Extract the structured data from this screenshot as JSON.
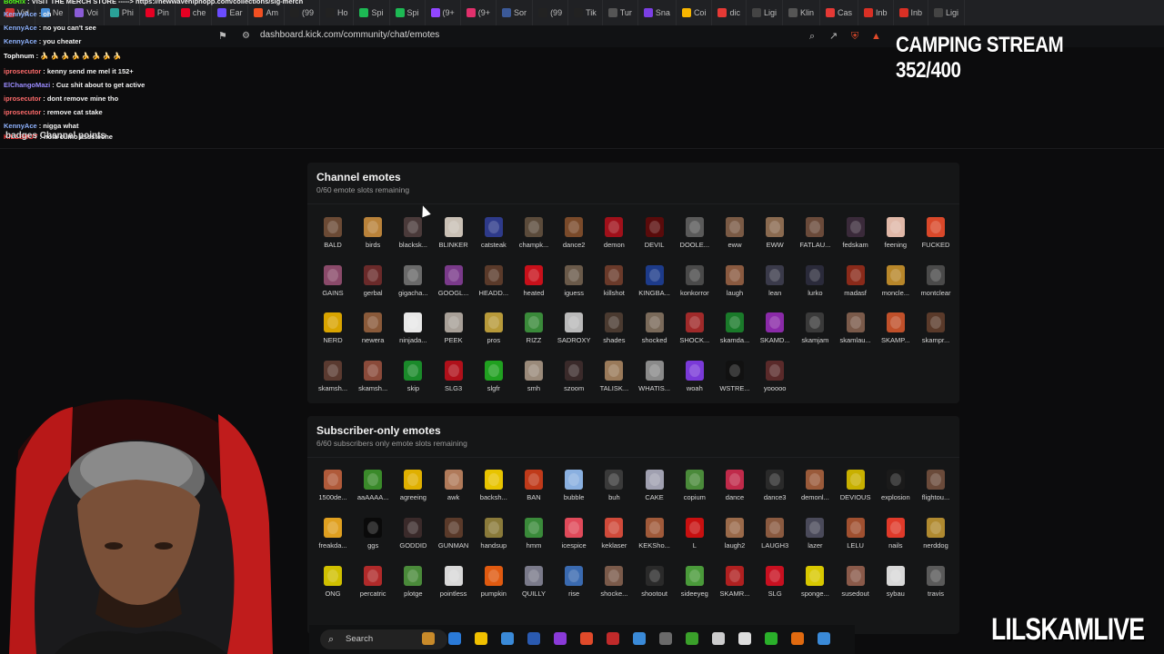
{
  "browser": {
    "tabs": [
      {
        "label": "Vid",
        "color": "#cc3333"
      },
      {
        "label": "Ne",
        "color": "#4a90d9"
      },
      {
        "label": "Voi",
        "color": "#8a5cd6"
      },
      {
        "label": "Phi",
        "color": "#2aa198"
      },
      {
        "label": "Pin",
        "color": "#e60023"
      },
      {
        "label": "che",
        "color": "#e60023"
      },
      {
        "label": "Ear",
        "color": "#6a4cff"
      },
      {
        "label": "Am",
        "color": "#f25022"
      },
      {
        "label": "(99",
        "color": "#222"
      },
      {
        "label": "Ho",
        "color": "#222"
      },
      {
        "label": "Spi",
        "color": "#1db954"
      },
      {
        "label": "Spi",
        "color": "#1db954"
      },
      {
        "label": "(9+",
        "color": "#9146ff"
      },
      {
        "label": "(9+",
        "color": "#e1306c"
      },
      {
        "label": "Sor",
        "color": "#3b5998"
      },
      {
        "label": "(99",
        "color": "#222"
      },
      {
        "label": "Tik",
        "color": "#222"
      },
      {
        "label": "Tur",
        "color": "#555"
      },
      {
        "label": "Sna",
        "color": "#7b3fe4"
      },
      {
        "label": "Coi",
        "color": "#f7b500"
      },
      {
        "label": "dic",
        "color": "#e53935"
      },
      {
        "label": "Ligi",
        "color": "#444"
      },
      {
        "label": "Klin",
        "color": "#555"
      },
      {
        "label": "Cas",
        "color": "#e53935"
      },
      {
        "label": "Inb",
        "color": "#d93025"
      },
      {
        "label": "Inb",
        "color": "#d93025"
      },
      {
        "label": "Ligi",
        "color": "#444"
      }
    ],
    "url": "dashboard.kick.com/community/chat/emotes"
  },
  "chat": {
    "lines": [
      {
        "user": "BotRix",
        "msg": ": VISIT THE MERCH STORE -----> https://newwavehiphopp.com/collections/slg-merch",
        "ucolor": "#53fc18"
      },
      {
        "user": "KennyAce",
        "msg": ": oh",
        "ucolor": "#8fb3ff"
      },
      {
        "user": "KennyAce",
        "msg": ": no you can't see",
        "ucolor": "#8fb3ff"
      },
      {
        "user": "KennyAce",
        "msg": ": you cheater",
        "ucolor": "#8fb3ff"
      },
      {
        "user": "Tophnum",
        "msg": ": 🍌 🍌 🍌 🍌 🍌 🍌 🍌 🍌",
        "ucolor": "#ffffff"
      },
      {
        "user": "iprosecutor",
        "msg": ": kenny send me mel it 152+",
        "ucolor": "#ff6b6b"
      },
      {
        "user": "ElChangoMazi",
        "msg": ": Cuz shit about to get active",
        "ucolor": "#9b8cff"
      },
      {
        "user": "iprosecutor",
        "msg": ": dont remove mine tho",
        "ucolor": "#ff6b6b"
      },
      {
        "user": "iprosecutor",
        "msg": ": remove cat stake",
        "ucolor": "#ff6b6b"
      },
      {
        "user": "KennyAce",
        "msg": ": nigga what",
        "ucolor": "#8fb3ff"
      },
      {
        "user": "KILLSHOT",
        "msg": ": hola cumo asssteche",
        "ucolor": "#ff3b3b"
      }
    ]
  },
  "stream_title": "CAMPING STREAM 352/400",
  "nav_partial": "badges   Channel points",
  "channel_emotes": {
    "title": "Channel emotes",
    "subtitle": "0/60 emote slots remaining",
    "items": [
      {
        "n": "BALD",
        "c": "#6b4a35"
      },
      {
        "n": "birds",
        "c": "#b9823a"
      },
      {
        "n": "blacksk...",
        "c": "#4a3a3a"
      },
      {
        "n": "BLINKER",
        "c": "#c9c0b5"
      },
      {
        "n": "catsteak",
        "c": "#2e3a8a"
      },
      {
        "n": "champk...",
        "c": "#5b4b3b"
      },
      {
        "n": "dance2",
        "c": "#7a4a2a"
      },
      {
        "n": "demon",
        "c": "#a0101a"
      },
      {
        "n": "DEVIL",
        "c": "#5a0b0b"
      },
      {
        "n": "DOOLE...",
        "c": "#5a5a5a"
      },
      {
        "n": "eww",
        "c": "#7a5a45"
      },
      {
        "n": "EWW",
        "c": "#8a6a50"
      },
      {
        "n": "FATLAU...",
        "c": "#6a4a3a"
      },
      {
        "n": "fedskam",
        "c": "#3a2a3a"
      },
      {
        "n": "feening",
        "c": "#e0b8a8"
      },
      {
        "n": "FUCKED",
        "c": "#d9482a"
      },
      {
        "n": "GAINS",
        "c": "#8a4a6a"
      },
      {
        "n": "gerbal",
        "c": "#6a2a2a"
      },
      {
        "n": "gigacha...",
        "c": "#6a6a6a"
      },
      {
        "n": "GOOGL...",
        "c": "#7a3a8a"
      },
      {
        "n": "HEADD...",
        "c": "#5a3a2a"
      },
      {
        "n": "heated",
        "c": "#c8101a"
      },
      {
        "n": "iguess",
        "c": "#6a5a4a"
      },
      {
        "n": "killshot",
        "c": "#6a3a2a"
      },
      {
        "n": "KINGBA...",
        "c": "#1d3b8a"
      },
      {
        "n": "konkorror",
        "c": "#4a4a4a"
      },
      {
        "n": "laugh",
        "c": "#8a5a40"
      },
      {
        "n": "lean",
        "c": "#3a3a4a"
      },
      {
        "n": "lurko",
        "c": "#2a2a3a"
      },
      {
        "n": "madasf",
        "c": "#8a2a1a"
      },
      {
        "n": "moncle...",
        "c": "#b8872a"
      },
      {
        "n": "montclear",
        "c": "#4a4a4a"
      },
      {
        "n": "NERD",
        "c": "#d9a400"
      },
      {
        "n": "newera",
        "c": "#8a5a3a"
      },
      {
        "n": "ninjada...",
        "c": "#e8e8e8"
      },
      {
        "n": "PEEK",
        "c": "#a8a098"
      },
      {
        "n": "pros",
        "c": "#b89a3a"
      },
      {
        "n": "RIZZ",
        "c": "#3a8a3a"
      },
      {
        "n": "SADROXY",
        "c": "#bababa"
      },
      {
        "n": "shades",
        "c": "#4a3a30"
      },
      {
        "n": "shocked",
        "c": "#7a6a5a"
      },
      {
        "n": "SHOCK...",
        "c": "#a02a2a"
      },
      {
        "n": "skamda...",
        "c": "#1a7a2a"
      },
      {
        "n": "SKAMD...",
        "c": "#8a2aa8"
      },
      {
        "n": "skamjam",
        "c": "#3a3a3a"
      },
      {
        "n": "skamlau...",
        "c": "#7a5a4a"
      },
      {
        "n": "SKAMP...",
        "c": "#c0502a"
      },
      {
        "n": "skampr...",
        "c": "#5a3a2a"
      },
      {
        "n": "skamsh...",
        "c": "#5a3a30"
      },
      {
        "n": "skamsh...",
        "c": "#8a4a3a"
      },
      {
        "n": "skip",
        "c": "#1a8a2a"
      },
      {
        "n": "SLG3",
        "c": "#b0101a"
      },
      {
        "n": "slgfr",
        "c": "#20a020"
      },
      {
        "n": "smh",
        "c": "#9a8a7a"
      },
      {
        "n": "szoom",
        "c": "#3a2a2a"
      },
      {
        "n": "TALISK...",
        "c": "#9a7a5a"
      },
      {
        "n": "WHATIS...",
        "c": "#8a8a8a"
      },
      {
        "n": "woah",
        "c": "#7a3ad8"
      },
      {
        "n": "WSTRE...",
        "c": "#111111"
      },
      {
        "n": "yooooo",
        "c": "#5a2a2a"
      }
    ]
  },
  "subscriber_emotes": {
    "title": "Subscriber-only emotes",
    "subtitle": "6/60 subscribers only emote slots remaining",
    "items": [
      {
        "n": "1500de...",
        "c": "#b05a3a"
      },
      {
        "n": "aaAAAA...",
        "c": "#3a8a2a"
      },
      {
        "n": "agreeing",
        "c": "#e0b000"
      },
      {
        "n": "awk",
        "c": "#b07a5a"
      },
      {
        "n": "backsh...",
        "c": "#e8c400"
      },
      {
        "n": "BAN",
        "c": "#c03a1a"
      },
      {
        "n": "bubble",
        "c": "#8ab0e0"
      },
      {
        "n": "buh",
        "c": "#3a3a3a"
      },
      {
        "n": "CAKE",
        "c": "#a0a0b0"
      },
      {
        "n": "copium",
        "c": "#4a8a3a"
      },
      {
        "n": "dance",
        "c": "#c02a4a"
      },
      {
        "n": "dance3",
        "c": "#2a2a2a"
      },
      {
        "n": "demonl...",
        "c": "#9a5a3a"
      },
      {
        "n": "DEVIOUS",
        "c": "#c8b000"
      },
      {
        "n": "explosion",
        "c": "#1a1a1a"
      },
      {
        "n": "flightou...",
        "c": "#6a4a3a"
      },
      {
        "n": "freakda...",
        "c": "#e0a020"
      },
      {
        "n": "ggs",
        "c": "#0a0a0a"
      },
      {
        "n": "GODDID",
        "c": "#3a2a2a"
      },
      {
        "n": "GUNMAN",
        "c": "#5a3a2a"
      },
      {
        "n": "handsup",
        "c": "#8a7a3a"
      },
      {
        "n": "hmm",
        "c": "#3a8a3a"
      },
      {
        "n": "icespice",
        "c": "#e04a5a"
      },
      {
        "n": "keklaser",
        "c": "#d04a3a"
      },
      {
        "n": "KEKSho...",
        "c": "#a05a3a"
      },
      {
        "n": "L",
        "c": "#c81010"
      },
      {
        "n": "laugh2",
        "c": "#9a6a4a"
      },
      {
        "n": "LAUGH3",
        "c": "#8a5a40"
      },
      {
        "n": "lazer",
        "c": "#4a4a5a"
      },
      {
        "n": "LELU",
        "c": "#a05030"
      },
      {
        "n": "nails",
        "c": "#e03a2a"
      },
      {
        "n": "nerddog",
        "c": "#b08a30"
      },
      {
        "n": "ONG",
        "c": "#d0c000"
      },
      {
        "n": "percatric",
        "c": "#b02a2a"
      },
      {
        "n": "plotge",
        "c": "#4a8a3a"
      },
      {
        "n": "pointless",
        "c": "#d8d8d8"
      },
      {
        "n": "pumpkin",
        "c": "#e05a10"
      },
      {
        "n": "QUILLY",
        "c": "#7a7a8a"
      },
      {
        "n": "rise",
        "c": "#3a6ab0"
      },
      {
        "n": "shocke...",
        "c": "#7a5a4a"
      },
      {
        "n": "shootout",
        "c": "#2a2a2a"
      },
      {
        "n": "sideeyeg",
        "c": "#4a9a3a"
      },
      {
        "n": "SKAMR...",
        "c": "#b02020"
      },
      {
        "n": "SLG",
        "c": "#c81020"
      },
      {
        "n": "sponge...",
        "c": "#d8c800"
      },
      {
        "n": "susedout",
        "c": "#8a5a4a"
      },
      {
        "n": "sybau",
        "c": "#d8d8d8"
      },
      {
        "n": "travis",
        "c": "#5a5a5a"
      }
    ]
  },
  "taskbar": {
    "search_label": "Search"
  },
  "watermark": "LILSKAMLIVE"
}
